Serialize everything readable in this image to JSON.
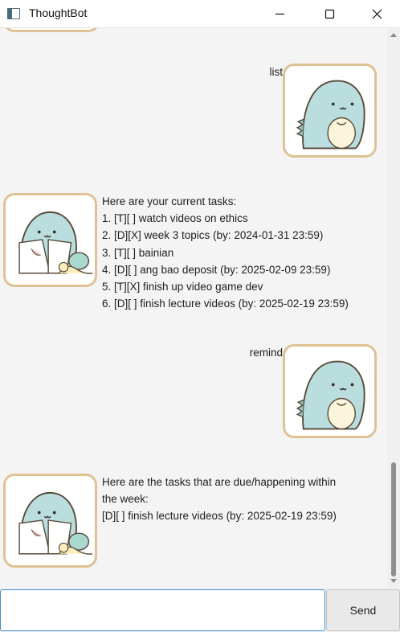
{
  "window": {
    "title": "ThoughtBot",
    "icons": {
      "app": "app-window-icon",
      "minimize": "minimize-icon",
      "maximize": "maximize-icon",
      "close": "close-icon"
    }
  },
  "messages": [
    {
      "sender": "user",
      "text": "list",
      "avatar": "dinosaur-avatar"
    },
    {
      "sender": "bot",
      "avatar": "bot-dinosaur-snail-avatar",
      "lines": [
        "Here are your current tasks:",
        "1. [T][ ] watch videos on ethics",
        "2. [D][X] week 3 topics (by: 2024-01-31 23:59)",
        "3. [T][ ] bainian",
        "4. [D][ ] ang bao deposit (by: 2025-02-09 23:59)",
        "5. [T][X] finish up video game dev",
        "6. [D][ ] finish lecture videos (by: 2025-02-19 23:59)"
      ]
    },
    {
      "sender": "user",
      "text": "remind",
      "avatar": "dinosaur-avatar"
    },
    {
      "sender": "bot",
      "avatar": "bot-dinosaur-snail-avatar",
      "lines": [
        "Here are the tasks that are due/happening within",
        "the week:",
        "[D][ ] finish lecture videos (by: 2025-02-19 23:59)"
      ]
    }
  ],
  "input": {
    "value": "",
    "placeholder": ""
  },
  "send_button": {
    "label": "Send"
  },
  "colors": {
    "avatar_border": "#dfc293",
    "input_focus_border": "#3b8ed8",
    "dino_body": "#b9dedd"
  }
}
